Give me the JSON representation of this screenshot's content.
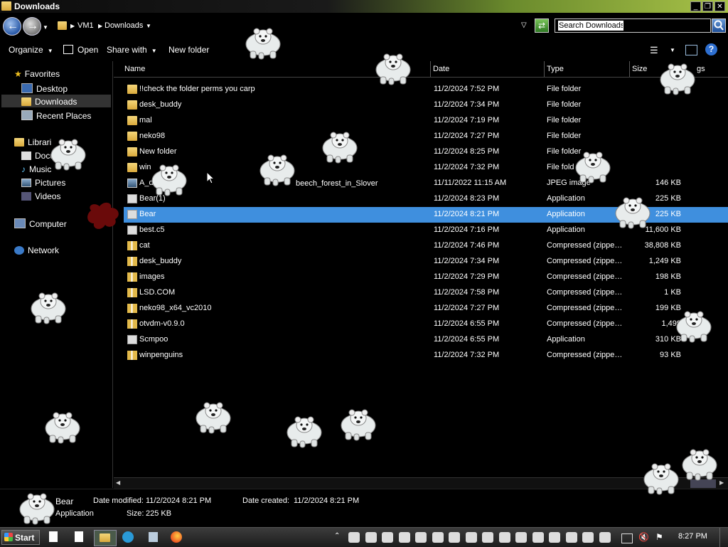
{
  "window": {
    "title": "Downloads"
  },
  "address": {
    "breadcrumbs": [
      "VM1",
      "Downloads"
    ],
    "search_placeholder": "Search Downloads"
  },
  "toolbar": {
    "organize": "Organize",
    "open": "Open",
    "share_with": "Share with",
    "new_folder": "New folder"
  },
  "nav": {
    "favorites": "Favorites",
    "desktop": "Desktop",
    "downloads": "Downloads",
    "recent_places": "Recent Places",
    "libraries": "Librari",
    "documents": "Docu",
    "music": "Music",
    "pictures": "Pictures",
    "videos": "Videos",
    "computer": "Computer",
    "network": "Network"
  },
  "columns": {
    "name": "Name",
    "date": "Date",
    "type": "Type",
    "size": "Size",
    "tags": "gs"
  },
  "files": [
    {
      "name": "!!check the folder perms you carp",
      "date": "11/2/2024 7:52 PM",
      "type": "File folder",
      "size": "",
      "icon": "folder"
    },
    {
      "name": "desk_buddy",
      "date": "11/2/2024 7:34 PM",
      "type": "File folder",
      "size": "",
      "icon": "folder"
    },
    {
      "name": "mal",
      "date": "11/2/2024 7:19 PM",
      "type": "File folder",
      "size": "",
      "icon": "folder"
    },
    {
      "name": "neko98",
      "date": "11/2/2024 7:27 PM",
      "type": "File folder",
      "size": "",
      "icon": "folder"
    },
    {
      "name": "New folder",
      "date": "11/2/2024 8:25 PM",
      "type": "File folder",
      "size": "",
      "icon": "folder"
    },
    {
      "name": "win",
      "date": "11/2/2024 7:32 PM",
      "type": "File fold",
      "size": "",
      "icon": "folder"
    },
    {
      "name": "A_d",
      "date": "11/11/2022 11:15 AM",
      "type": "JPEG image",
      "size": "146 KB",
      "icon": "image"
    },
    {
      "name": "Bear(1)",
      "date": "11/2/2024 8:23 PM",
      "type": "Application",
      "size": "225 KB",
      "icon": "app"
    },
    {
      "name": "Bear",
      "date": "11/2/2024 8:21 PM",
      "type": "Application",
      "size": "225 KB",
      "icon": "app",
      "selected": true
    },
    {
      "name": "best.c5",
      "date": "11/2/2024 7:16 PM",
      "type": "Application",
      "size": "11,600 KB",
      "icon": "app"
    },
    {
      "name": "cat",
      "date": "11/2/2024 7:46 PM",
      "type": "Compressed (zippe…",
      "size": "38,808 KB",
      "icon": "zip"
    },
    {
      "name": "desk_buddy",
      "date": "11/2/2024 7:34 PM",
      "type": "Compressed (zippe…",
      "size": "1,249 KB",
      "icon": "zip"
    },
    {
      "name": "images",
      "date": "11/2/2024 7:29 PM",
      "type": "Compressed (zippe…",
      "size": "198 KB",
      "icon": "zip"
    },
    {
      "name": "LSD.COM",
      "date": "11/2/2024 7:58 PM",
      "type": "Compressed (zippe…",
      "size": "1 KB",
      "icon": "zip"
    },
    {
      "name": "neko98_x64_vc2010",
      "date": "11/2/2024 7:27 PM",
      "type": "Compressed (zippe…",
      "size": "199 KB",
      "icon": "zip"
    },
    {
      "name": "otvdm-v0.9.0",
      "date": "11/2/2024 6:55 PM",
      "type": "Compressed (zippe…",
      "size": "1,499",
      "icon": "zip"
    },
    {
      "name": "Scmpoo",
      "date": "11/2/2024 6:55 PM",
      "type": "Application",
      "size": "310 KB",
      "icon": "app"
    },
    {
      "name": "winpenguins",
      "date": "11/2/2024 7:32 PM",
      "type": "Compressed (zippe…",
      "size": "93 KB",
      "icon": "zip"
    }
  ],
  "file_partial_text": "beech_forest_in_Slover",
  "details": {
    "name": "Bear",
    "type": "Application",
    "modified_label": "Date modified:",
    "modified": "11/2/2024 8:21 PM",
    "created_label": "Date created:",
    "created": "11/2/2024 8:21 PM",
    "size_label": "Size:",
    "size": "225 KB"
  },
  "taskbar": {
    "start": "Start",
    "clock": "8:27 PM"
  },
  "colors": {
    "selection": "#3f8fde",
    "background": "#000000",
    "titlebar_accent": "#a8c248"
  }
}
